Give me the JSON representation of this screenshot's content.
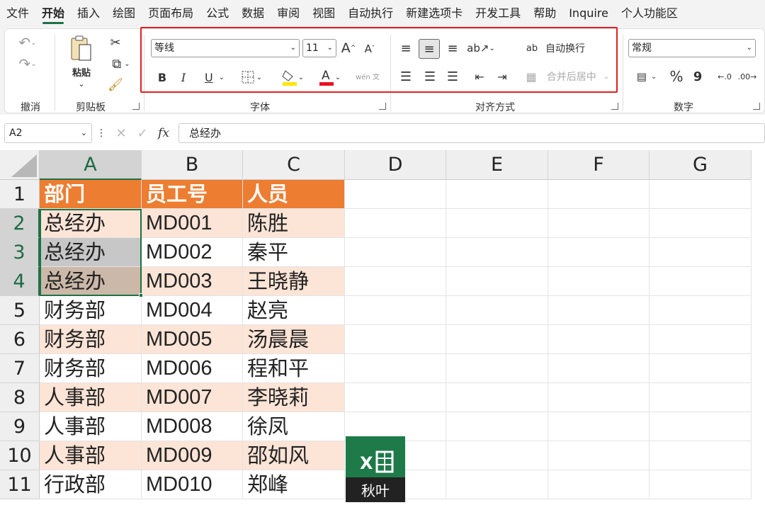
{
  "menubar": {
    "tabs": [
      "文件",
      "开始",
      "插入",
      "绘图",
      "页面布局",
      "公式",
      "数据",
      "审阅",
      "视图",
      "自动执行",
      "新建选项卡",
      "开发工具",
      "帮助",
      "Inquire",
      "个人功能区"
    ],
    "active_tab": "开始"
  },
  "ribbon": {
    "clipboard": {
      "paste_label": "粘贴",
      "group_label": "剪贴板"
    },
    "undo": {
      "group_label": "撤消"
    },
    "font": {
      "font_name": "等线",
      "font_size": "11",
      "group_label": "字体",
      "bold": "B",
      "italic": "I",
      "underline": "U",
      "grow": "A",
      "shrink": "A",
      "font_color": "#e81123",
      "fill_color": "#ffe600",
      "phonetic": "wén 文"
    },
    "alignment": {
      "wrap_text": "自动换行",
      "merge_center": "合并后居中",
      "group_label": "对齐方式"
    },
    "number": {
      "format": "常规",
      "group_label": "数字",
      "percent": "%",
      "comma": "9"
    }
  },
  "formula_bar": {
    "name_box": "A2",
    "fx_label": "fx",
    "content": "总经办"
  },
  "sheet": {
    "columns": [
      "A",
      "B",
      "C",
      "D",
      "E",
      "F",
      "G"
    ],
    "rows": [
      "1",
      "2",
      "3",
      "4",
      "5",
      "6",
      "7",
      "8",
      "9",
      "10",
      "11"
    ],
    "header": [
      "部门",
      "员工号",
      "人员"
    ],
    "data": [
      [
        "总经办",
        "MD001",
        "陈胜"
      ],
      [
        "总经办",
        "MD002",
        "秦平"
      ],
      [
        "总经办",
        "MD003",
        "王晓静"
      ],
      [
        "财务部",
        "MD004",
        "赵亮"
      ],
      [
        "财务部",
        "MD005",
        "汤晨晨"
      ],
      [
        "财务部",
        "MD006",
        "程和平"
      ],
      [
        "人事部",
        "MD007",
        "李晓莉"
      ],
      [
        "人事部",
        "MD008",
        "徐凤"
      ],
      [
        "人事部",
        "MD009",
        "邵如风"
      ],
      [
        "行政部",
        "MD010",
        "郑峰"
      ]
    ],
    "header_color": "#ed7d31",
    "band_color": "#fce4d6"
  },
  "watermark": {
    "text": "秋叶",
    "letter": "X"
  }
}
